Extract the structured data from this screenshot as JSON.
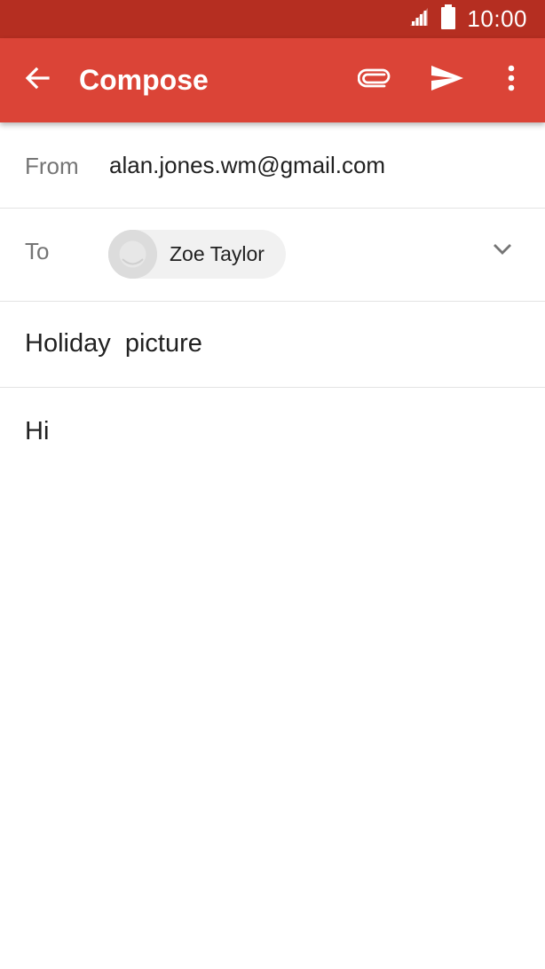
{
  "status_bar": {
    "time": "10:00",
    "signal_icon": "cell-signal-icon",
    "battery_icon": "battery-icon",
    "bg_color": "#b52e21"
  },
  "app_bar": {
    "title": "Compose",
    "back_icon": "arrow-back-icon",
    "attach_icon": "paperclip-icon",
    "send_icon": "send-icon",
    "more_icon": "more-vert-icon",
    "bg_color": "#db4437"
  },
  "from": {
    "label": "From",
    "value": "alan.jones.wm@gmail.com"
  },
  "to": {
    "label": "To",
    "recipients": [
      {
        "name": "Zoe Taylor",
        "avatar_icon": "person-avatar-icon"
      }
    ],
    "expand_icon": "chevron-down-icon"
  },
  "subject": {
    "value": "Holiday  picture"
  },
  "body": {
    "value": "Hi"
  }
}
